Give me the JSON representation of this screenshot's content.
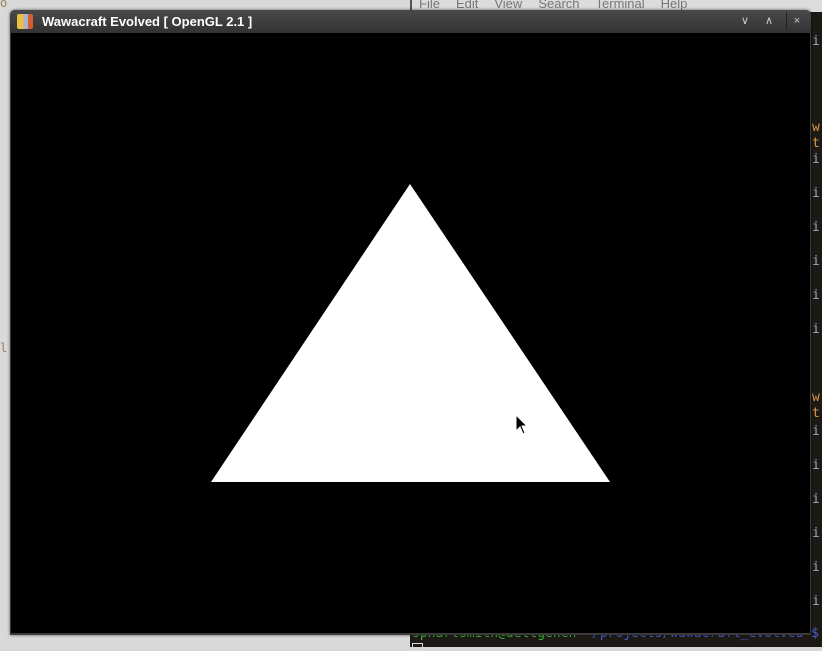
{
  "background_window": {
    "left_chars": [
      "o",
      "l"
    ]
  },
  "terminal": {
    "menu": [
      "File",
      "Edit",
      "View",
      "Search",
      "Terminal",
      "Help"
    ],
    "visible_chars": [
      "i",
      "w",
      "t",
      "i",
      "i",
      "i",
      "i",
      "i",
      "i",
      "w",
      "t",
      "i",
      "i",
      "i",
      "i",
      "i",
      "i"
    ],
    "prompt_user": "sphartsmith@dettgench",
    "prompt_path": " ~/projects/wawacraft_evolved $",
    "colors": {
      "blue": "#8fa8c8",
      "orange": "#d99a4a",
      "green": "#3fb83a"
    }
  },
  "game_window": {
    "title": "Wawacraft Evolved [ OpenGL 2.1 ]",
    "buttons": {
      "minimize": "∨",
      "maximize": "∧",
      "close": "×"
    },
    "triangle_color": "#ffffff",
    "clear_color": "#000000"
  }
}
